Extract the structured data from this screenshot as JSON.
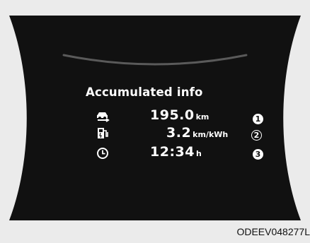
{
  "screen": {
    "title": "Accumulated info",
    "rows": [
      {
        "icon": "distance-icon",
        "value": "195.0",
        "unit": "km",
        "callout": "1"
      },
      {
        "icon": "fuel-pump-electric-icon",
        "value": "3.2",
        "unit": "km/kWh",
        "callout": "2"
      },
      {
        "icon": "clock-icon",
        "value": "12:34",
        "unit": "h",
        "callout": "3"
      }
    ]
  },
  "figure_code": "ODEEV048277L",
  "colors": {
    "background": "#ebebeb",
    "display": "#111111",
    "text": "#ffffff",
    "arc": "#5a5a5a"
  }
}
